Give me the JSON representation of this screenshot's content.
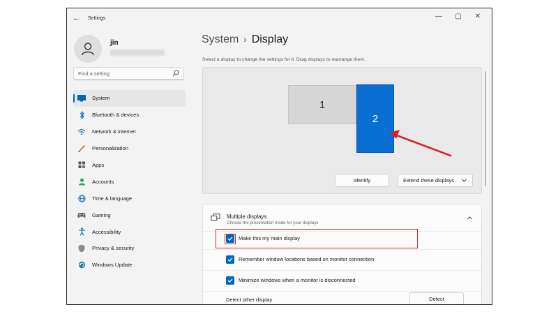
{
  "window": {
    "title": "Settings",
    "controls": [
      "—",
      "▢",
      "✕"
    ]
  },
  "user": {
    "name": "jin"
  },
  "search": {
    "placeholder": "Find a setting"
  },
  "sidebar": {
    "items": [
      {
        "label": "System",
        "icon": "monitor-icon",
        "active": true
      },
      {
        "label": "Bluetooth & devices",
        "icon": "bluetooth-icon"
      },
      {
        "label": "Network & internet",
        "icon": "wifi-icon"
      },
      {
        "label": "Personalization",
        "icon": "brush-icon"
      },
      {
        "label": "Apps",
        "icon": "apps-icon"
      },
      {
        "label": "Accounts",
        "icon": "person-icon"
      },
      {
        "label": "Time & language",
        "icon": "globe-clock-icon"
      },
      {
        "label": "Gaming",
        "icon": "gamepad-icon"
      },
      {
        "label": "Accessibility",
        "icon": "accessibility-icon"
      },
      {
        "label": "Privacy & security",
        "icon": "shield-icon"
      },
      {
        "label": "Windows Update",
        "icon": "update-icon"
      }
    ]
  },
  "breadcrumb": {
    "parent": "System",
    "separator": "›",
    "current": "Display"
  },
  "display_arrangement": {
    "instruction": "Select a display to change the settings for it. Drag displays to rearrange them.",
    "monitors": [
      "1",
      "2"
    ],
    "selected_monitor": "2",
    "identify_label": "Identify",
    "mode_selected": "Extend these displays"
  },
  "multiple_displays": {
    "title": "Multiple displays",
    "subtitle": "Choose the presentation mode for your displays",
    "options": [
      {
        "label": "Make this my main display",
        "checked": true
      },
      {
        "label": "Remember window locations based on monitor connection",
        "checked": true
      },
      {
        "label": "Minimize windows when a monitor is disconnected",
        "checked": true
      }
    ],
    "detect_label": "Detect other display",
    "detect_button": "Detect"
  },
  "colors": {
    "accent": "#0067c0",
    "selected_monitor": "#0a6fd3",
    "annotation_red": "#d6232b"
  }
}
